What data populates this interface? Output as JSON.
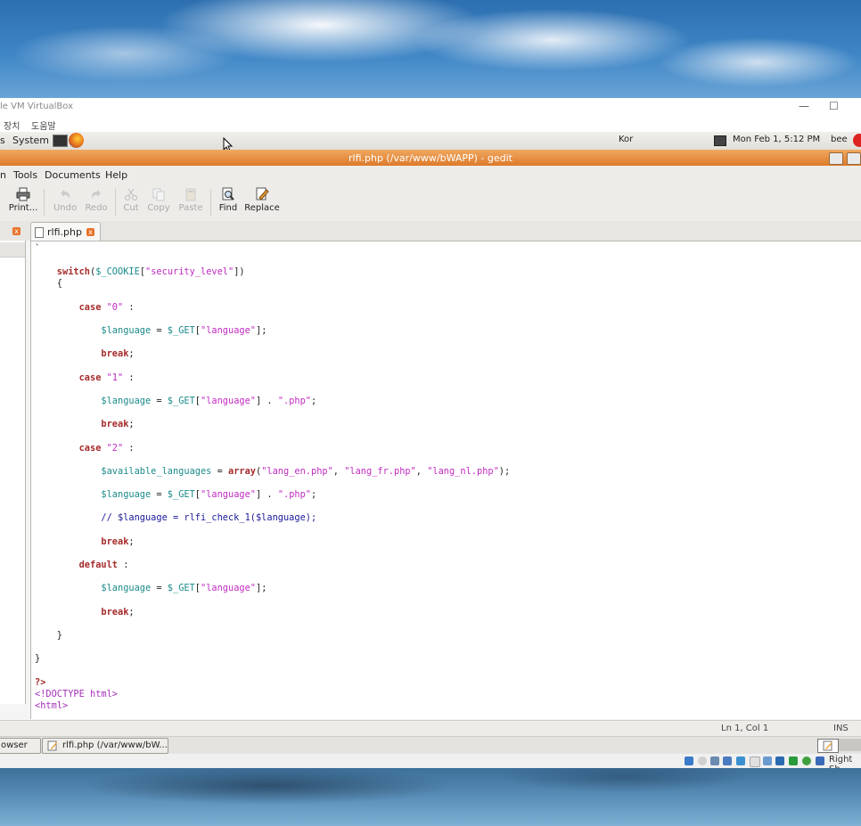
{
  "vbox": {
    "title": "le VM VirtualBox",
    "menu": [
      "장치",
      "도움말"
    ],
    "min_glyph": "—",
    "max_glyph": "☐"
  },
  "panel": {
    "left_label": "s",
    "system_label": "System",
    "keyboard": "Kor",
    "datetime": "Mon Feb  1,  5:12 PM",
    "user": "bee"
  },
  "gedit": {
    "window_title": "rlfi.php (/var/www/bWAPP) - gedit",
    "menu": {
      "partial": "n",
      "tools": "Tools",
      "documents": "Documents",
      "help": "Help"
    },
    "toolbar": {
      "print": "Print...",
      "undo": "Undo",
      "redo": "Redo",
      "cut": "Cut",
      "copy": "Copy",
      "paste": "Paste",
      "find": "Find",
      "replace": "Replace"
    },
    "tab_label": "rlfi.php",
    "close_glyph": "x"
  },
  "code_lines": [
    {
      "segs": [
        {
          "c": "plain",
          "t": "`"
        }
      ]
    },
    {
      "segs": []
    },
    {
      "segs": [
        {
          "c": "kw",
          "t": "    switch"
        },
        {
          "c": "plain",
          "t": "("
        },
        {
          "c": "var",
          "t": "$_COOKIE"
        },
        {
          "c": "plain",
          "t": "["
        },
        {
          "c": "str",
          "t": "\"security_level\""
        },
        {
          "c": "plain",
          "t": "])"
        }
      ]
    },
    {
      "segs": [
        {
          "c": "plain",
          "t": "    {"
        }
      ]
    },
    {
      "segs": []
    },
    {
      "segs": [
        {
          "c": "kw",
          "t": "        case "
        },
        {
          "c": "str",
          "t": "\"0\""
        },
        {
          "c": "plain",
          "t": " :"
        }
      ]
    },
    {
      "segs": []
    },
    {
      "segs": [
        {
          "c": "var",
          "t": "            $language"
        },
        {
          "c": "plain",
          "t": " = "
        },
        {
          "c": "var",
          "t": "$_GET"
        },
        {
          "c": "plain",
          "t": "["
        },
        {
          "c": "str",
          "t": "\"language\""
        },
        {
          "c": "plain",
          "t": "];"
        }
      ]
    },
    {
      "segs": []
    },
    {
      "segs": [
        {
          "c": "kw",
          "t": "            break"
        },
        {
          "c": "plain",
          "t": ";"
        }
      ]
    },
    {
      "segs": []
    },
    {
      "segs": [
        {
          "c": "kw",
          "t": "        case "
        },
        {
          "c": "str",
          "t": "\"1\""
        },
        {
          "c": "plain",
          "t": " :"
        }
      ]
    },
    {
      "segs": []
    },
    {
      "segs": [
        {
          "c": "var",
          "t": "            $language"
        },
        {
          "c": "plain",
          "t": " = "
        },
        {
          "c": "var",
          "t": "$_GET"
        },
        {
          "c": "plain",
          "t": "["
        },
        {
          "c": "str",
          "t": "\"language\""
        },
        {
          "c": "plain",
          "t": "] . "
        },
        {
          "c": "str",
          "t": "\".php\""
        },
        {
          "c": "plain",
          "t": ";"
        }
      ]
    },
    {
      "segs": []
    },
    {
      "segs": [
        {
          "c": "kw",
          "t": "            break"
        },
        {
          "c": "plain",
          "t": ";"
        }
      ]
    },
    {
      "segs": []
    },
    {
      "segs": [
        {
          "c": "kw",
          "t": "        case "
        },
        {
          "c": "str",
          "t": "\"2\""
        },
        {
          "c": "plain",
          "t": " :"
        }
      ]
    },
    {
      "segs": []
    },
    {
      "segs": [
        {
          "c": "var",
          "t": "            $available_languages"
        },
        {
          "c": "plain",
          "t": " = "
        },
        {
          "c": "kw",
          "t": "array"
        },
        {
          "c": "plain",
          "t": "("
        },
        {
          "c": "str",
          "t": "\"lang_en.php\""
        },
        {
          "c": "plain",
          "t": ", "
        },
        {
          "c": "str",
          "t": "\"lang_fr.php\""
        },
        {
          "c": "plain",
          "t": ", "
        },
        {
          "c": "str",
          "t": "\"lang_nl.php\""
        },
        {
          "c": "plain",
          "t": ");"
        }
      ]
    },
    {
      "segs": []
    },
    {
      "segs": [
        {
          "c": "var",
          "t": "            $language"
        },
        {
          "c": "plain",
          "t": " = "
        },
        {
          "c": "var",
          "t": "$_GET"
        },
        {
          "c": "plain",
          "t": "["
        },
        {
          "c": "str",
          "t": "\"language\""
        },
        {
          "c": "plain",
          "t": "] . "
        },
        {
          "c": "str",
          "t": "\".php\""
        },
        {
          "c": "plain",
          "t": ";"
        }
      ]
    },
    {
      "segs": []
    },
    {
      "segs": [
        {
          "c": "cmt",
          "t": "            // $language = rlfi_check_1($language);"
        }
      ]
    },
    {
      "segs": []
    },
    {
      "segs": [
        {
          "c": "kw",
          "t": "            break"
        },
        {
          "c": "plain",
          "t": ";"
        }
      ]
    },
    {
      "segs": []
    },
    {
      "segs": [
        {
          "c": "kw",
          "t": "        default"
        },
        {
          "c": "plain",
          "t": " :"
        }
      ]
    },
    {
      "segs": []
    },
    {
      "segs": [
        {
          "c": "var",
          "t": "            $language"
        },
        {
          "c": "plain",
          "t": " = "
        },
        {
          "c": "var",
          "t": "$_GET"
        },
        {
          "c": "plain",
          "t": "["
        },
        {
          "c": "str",
          "t": "\"language\""
        },
        {
          "c": "plain",
          "t": "];"
        }
      ]
    },
    {
      "segs": []
    },
    {
      "segs": [
        {
          "c": "kw",
          "t": "            break"
        },
        {
          "c": "plain",
          "t": ";"
        }
      ]
    },
    {
      "segs": []
    },
    {
      "segs": [
        {
          "c": "plain",
          "t": "    }"
        }
      ]
    },
    {
      "segs": []
    },
    {
      "segs": [
        {
          "c": "plain",
          "t": "}"
        }
      ]
    },
    {
      "segs": []
    },
    {
      "segs": [
        {
          "c": "kw",
          "t": "?>"
        }
      ]
    },
    {
      "segs": [
        {
          "c": "pp",
          "t": "<!DOCTYPE html>"
        }
      ]
    },
    {
      "segs": [
        {
          "c": "pp",
          "t": "<html>"
        }
      ]
    }
  ],
  "status": {
    "position": "Ln 1, Col 1",
    "mode": "INS"
  },
  "taskbar": {
    "item1": "owser",
    "item2": "rlfi.php (/var/www/bW..."
  },
  "vbox_status": {
    "host_key": "Right Sh"
  },
  "colors": {
    "title_orange": "#de7a2a",
    "keyword": "#a52a2a",
    "string": "#c02cc0",
    "variable": "#1b8a8a"
  }
}
